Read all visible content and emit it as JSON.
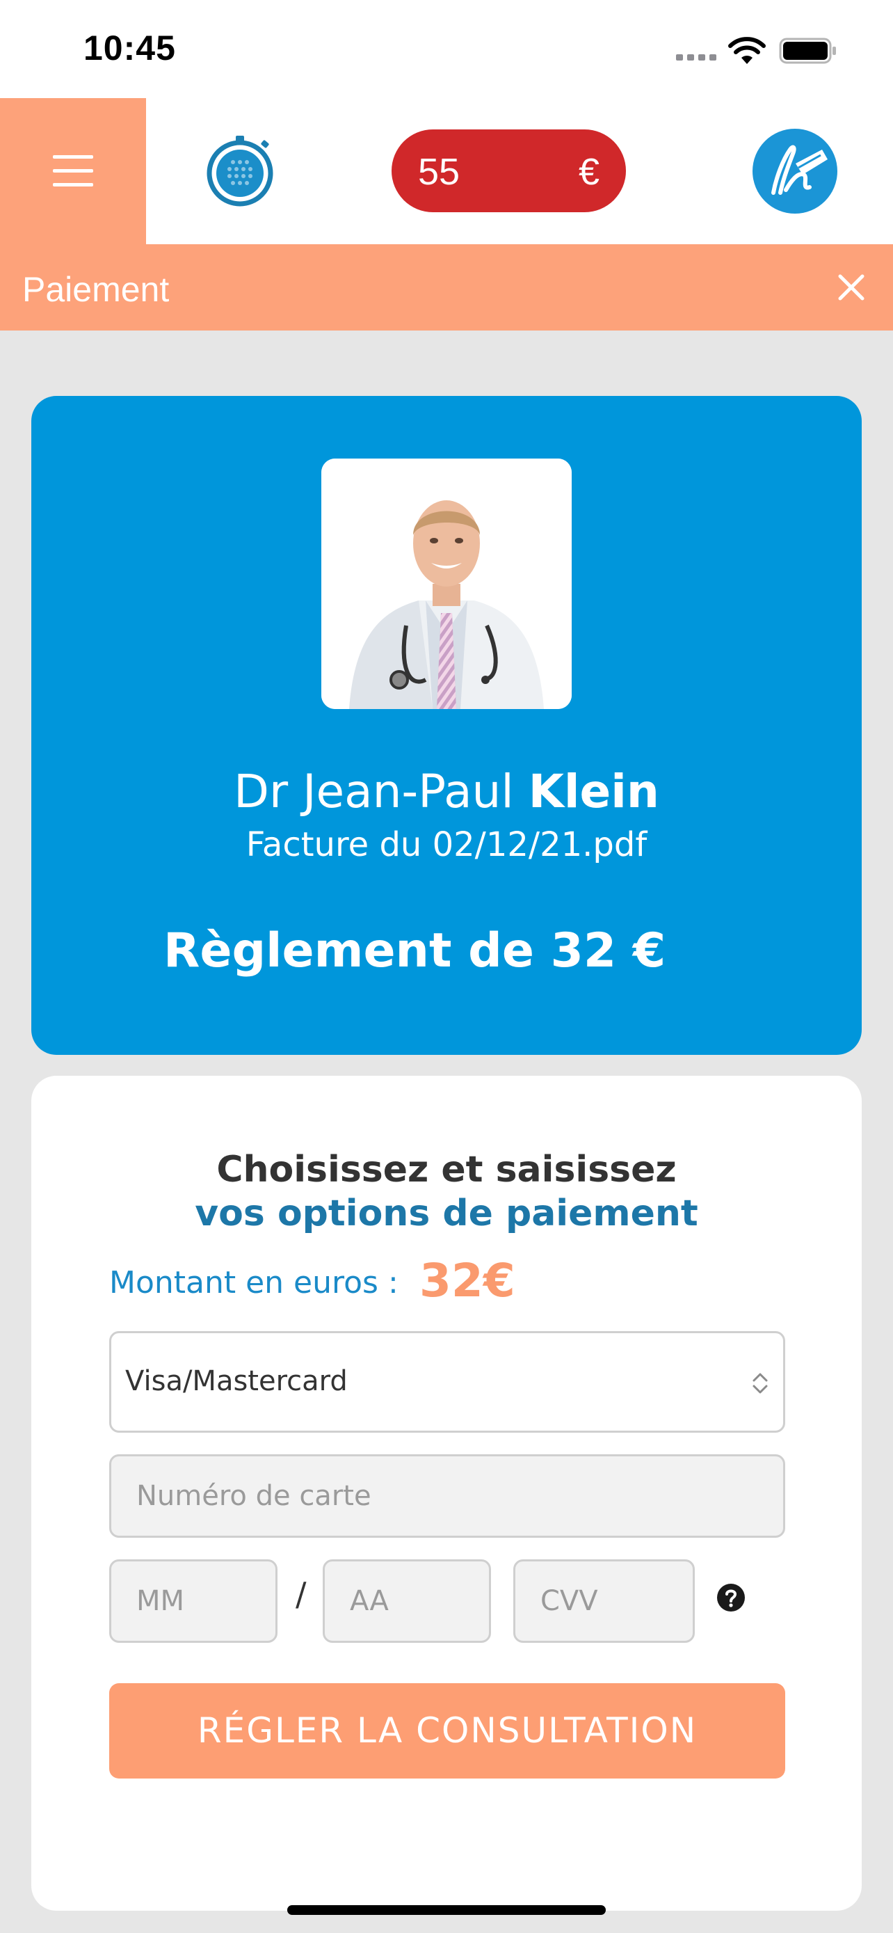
{
  "status_bar": {
    "time": "10:45"
  },
  "header": {
    "balance": {
      "amount": "55",
      "currency": "€"
    }
  },
  "title_bar": {
    "title": "Paiement"
  },
  "doctor_card": {
    "name_prefix": "Dr Jean-Paul",
    "name_last": "Klein",
    "invoice": "Facture du 02/12/21.pdf",
    "payment_title": "Règlement de 32 €"
  },
  "payment_form": {
    "heading_line1": "Choisissez et saisissez",
    "heading_line2": "vos options de paiement",
    "amount_label": "Montant en euros :",
    "amount_value": "32€",
    "card_type": "Visa/Mastercard",
    "card_number_placeholder": "Numéro de carte",
    "month_placeholder": "MM",
    "separator": "/",
    "year_placeholder": "AA",
    "cvv_placeholder": "CVV",
    "submit_label": "RÉGLER LA CONSULTATION"
  },
  "colors": {
    "accent_orange": "#fda27a",
    "brand_blue": "#0096db",
    "balance_red": "#d0282a"
  }
}
